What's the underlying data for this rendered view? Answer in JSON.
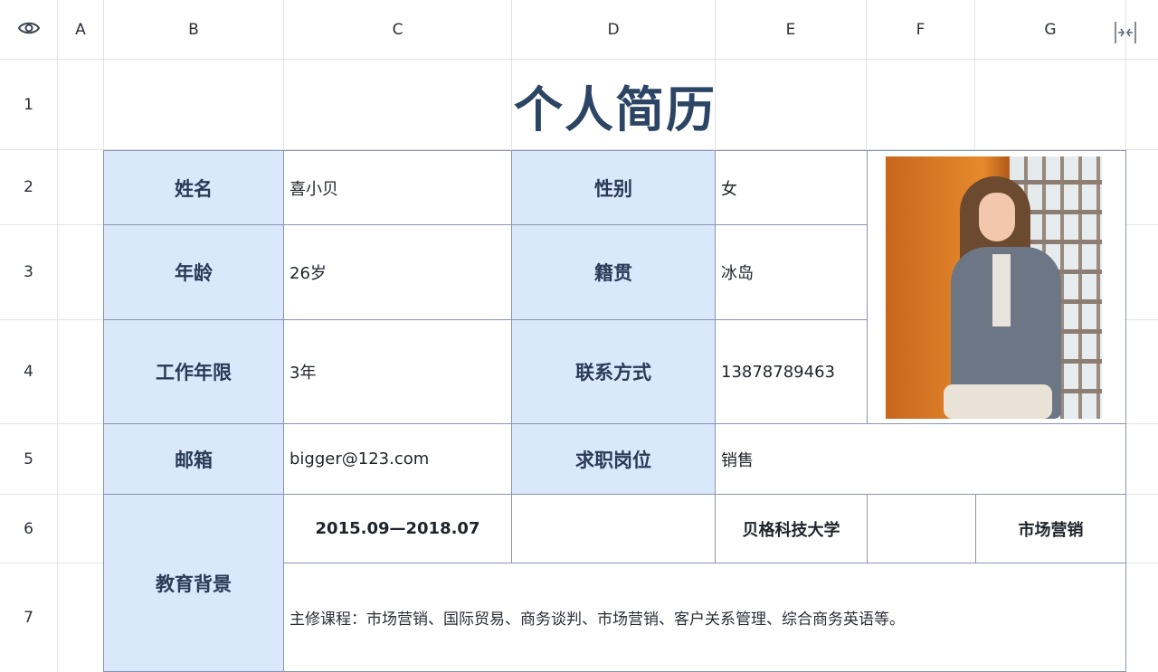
{
  "columns": [
    "A",
    "B",
    "C",
    "D",
    "E",
    "F",
    "G"
  ],
  "rows": [
    "1",
    "2",
    "3",
    "4",
    "5",
    "6",
    "7"
  ],
  "sheet": {
    "title": "个人简历",
    "name_label": "姓名",
    "name_value": "喜小贝",
    "gender_label": "性别",
    "gender_value": "女",
    "age_label": "年龄",
    "age_value": "26岁",
    "origin_label": "籍贯",
    "origin_value": "冰岛",
    "experience_label": "工作年限",
    "experience_value": "3年",
    "contact_label": "联系方式",
    "contact_value": "13878789463",
    "email_label": "邮箱",
    "email_value": "bigger@123.com",
    "position_label": "求职岗位",
    "position_value": "销售",
    "education_label": "教育背景",
    "education_period": "2015.09—2018.07",
    "education_school": "贝格科技大学",
    "education_major": "市场营销",
    "education_courses": "主修课程：市场营销、国际贸易、商务谈判、市场营销、客户关系管理、综合商务英语等。"
  },
  "icons": {
    "visibility": "eye-icon",
    "collapse": "collapse-columns-icon"
  },
  "colors": {
    "label_bg": "#d9e8fb",
    "title_text": "#2d4564",
    "table_border": "#8a93b4"
  }
}
